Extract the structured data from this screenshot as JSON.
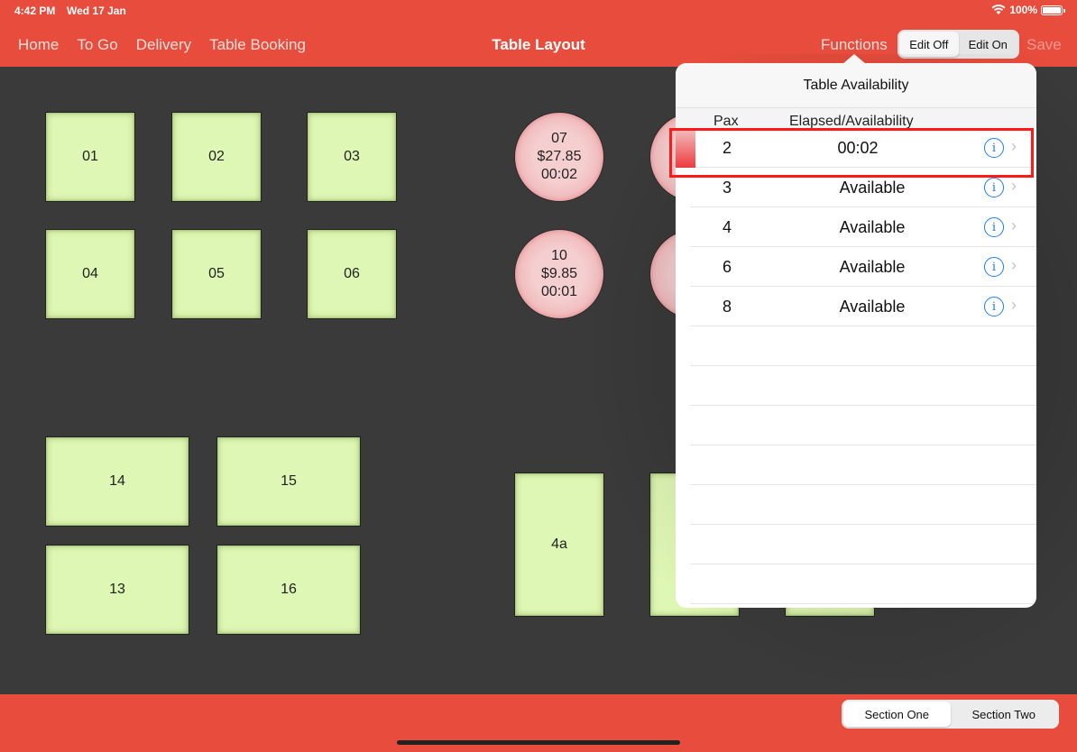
{
  "status_bar": {
    "time": "4:42 PM",
    "date": "Wed 17 Jan",
    "battery": "100%",
    "icons": [
      "wifi-icon",
      "battery-icon"
    ]
  },
  "nav": {
    "links": [
      "Home",
      "To Go",
      "Delivery",
      "Table Booking"
    ],
    "title": "Table Layout",
    "functions_label": "Functions",
    "edit_segment": {
      "options": [
        "Edit Off",
        "Edit On"
      ],
      "selected": "Edit Off"
    },
    "save_label": "Save"
  },
  "tables": {
    "square": [
      "01",
      "02",
      "03",
      "04",
      "05",
      "06"
    ],
    "rect": [
      "14",
      "15",
      "13",
      "16"
    ],
    "round": [
      {
        "number": "07",
        "amount": "$27.85",
        "elapsed": "00:02"
      },
      {
        "number": "10",
        "amount": "$9.85",
        "elapsed": "00:01"
      }
    ],
    "tall": [
      "4a"
    ]
  },
  "popover": {
    "title": "Table Availability",
    "columns": [
      "Pax",
      "Elapsed/Availability"
    ],
    "rows": [
      {
        "pax": "2",
        "status": "00:02",
        "occupied": true
      },
      {
        "pax": "3",
        "status": "Available",
        "occupied": false
      },
      {
        "pax": "4",
        "status": "Available",
        "occupied": false
      },
      {
        "pax": "6",
        "status": "Available",
        "occupied": false
      },
      {
        "pax": "8",
        "status": "Available",
        "occupied": false
      }
    ],
    "info_glyph": "i",
    "chevron_glyph": "›"
  },
  "bottom": {
    "section_segment": {
      "options": [
        "Section One",
        "Section Two"
      ],
      "selected": "Section One"
    }
  },
  "colors": {
    "brand": "#e74c3c",
    "floor": "#3a3a3a",
    "available_table": "#dff7b4",
    "occupied_table": "#f5cfd0",
    "info_blue": "#1a7cf5",
    "highlight_red": "#ff1a1a"
  }
}
